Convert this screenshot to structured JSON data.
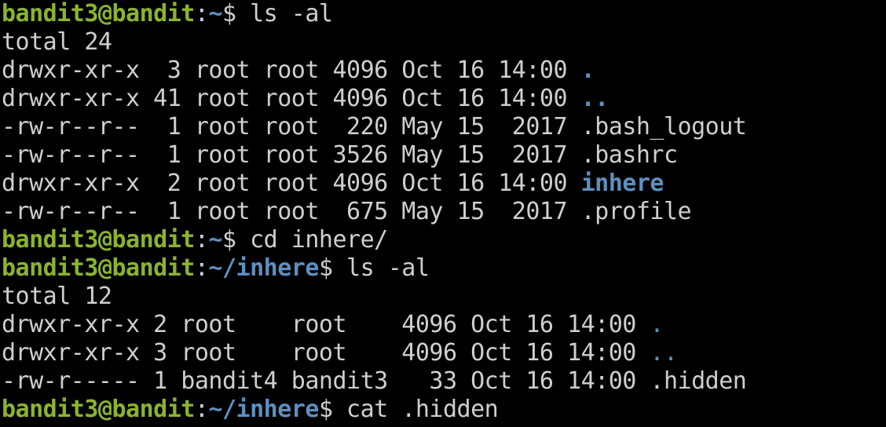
{
  "colors": {
    "background": "#000000",
    "prompt_user": "#8ab430",
    "directory": "#5f8fbf",
    "text": "#cfcfcf"
  },
  "prompt": {
    "user_host": "bandit3@bandit",
    "colon": ":",
    "home_path": "~",
    "inhere_path": "~/inhere",
    "dollar": "$"
  },
  "lines": {
    "l1": {
      "cmd": " ls -al"
    },
    "l2": {
      "text": "total 24"
    },
    "l3": {
      "meta": "drwxr-xr-x  3 root root 4096 Oct 16 14:00 ",
      "name": "."
    },
    "l4": {
      "meta": "drwxr-xr-x 41 root root 4096 Oct 16 14:00 ",
      "name": ".."
    },
    "l5": {
      "meta": "-rw-r--r--  1 root root  220 May 15  2017 ",
      "name": ".bash_logout"
    },
    "l6": {
      "meta": "-rw-r--r--  1 root root 3526 May 15  2017 ",
      "name": ".bashrc"
    },
    "l7": {
      "meta": "drwxr-xr-x  2 root root 4096 Oct 16 14:00 ",
      "name": "inhere"
    },
    "l8": {
      "meta": "-rw-r--r--  1 root root  675 May 15  2017 ",
      "name": ".profile"
    },
    "l9": {
      "cmd": " cd inhere/"
    },
    "l10": {
      "cmd": " ls -al"
    },
    "l11": {
      "text": "total 12"
    },
    "l12": {
      "meta": "drwxr-xr-x 2 root    root    4096 Oct 16 14:00 ",
      "name": "."
    },
    "l13": {
      "meta": "drwxr-xr-x 3 root    root    4096 Oct 16 14:00 ",
      "name": ".."
    },
    "l14": {
      "meta": "-rw-r----- 1 bandit4 bandit3   33 Oct 16 14:00 ",
      "name": ".hidden"
    },
    "l15": {
      "cmd": " cat .hidden"
    }
  }
}
